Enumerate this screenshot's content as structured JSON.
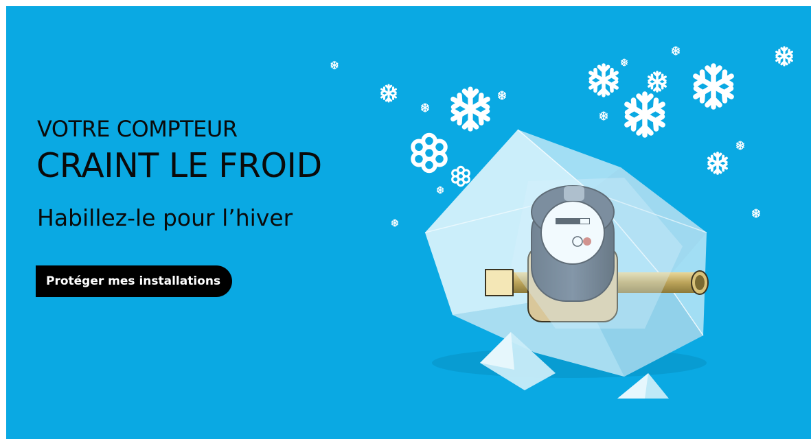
{
  "banner": {
    "headline_line1": "VOTRE COMPTEUR",
    "headline_line2": "CRAINT LE FROID",
    "subtitle": "Habillez-le pour l’hiver",
    "cta_label": "Protéger mes installations"
  },
  "colors": {
    "background": "#0aa9e3",
    "text": "#0a0a0a",
    "button": "#000000",
    "button_text": "#ffffff"
  },
  "illustration": {
    "subject": "water meter inside ice block",
    "decorations": "snowflake-icon"
  }
}
